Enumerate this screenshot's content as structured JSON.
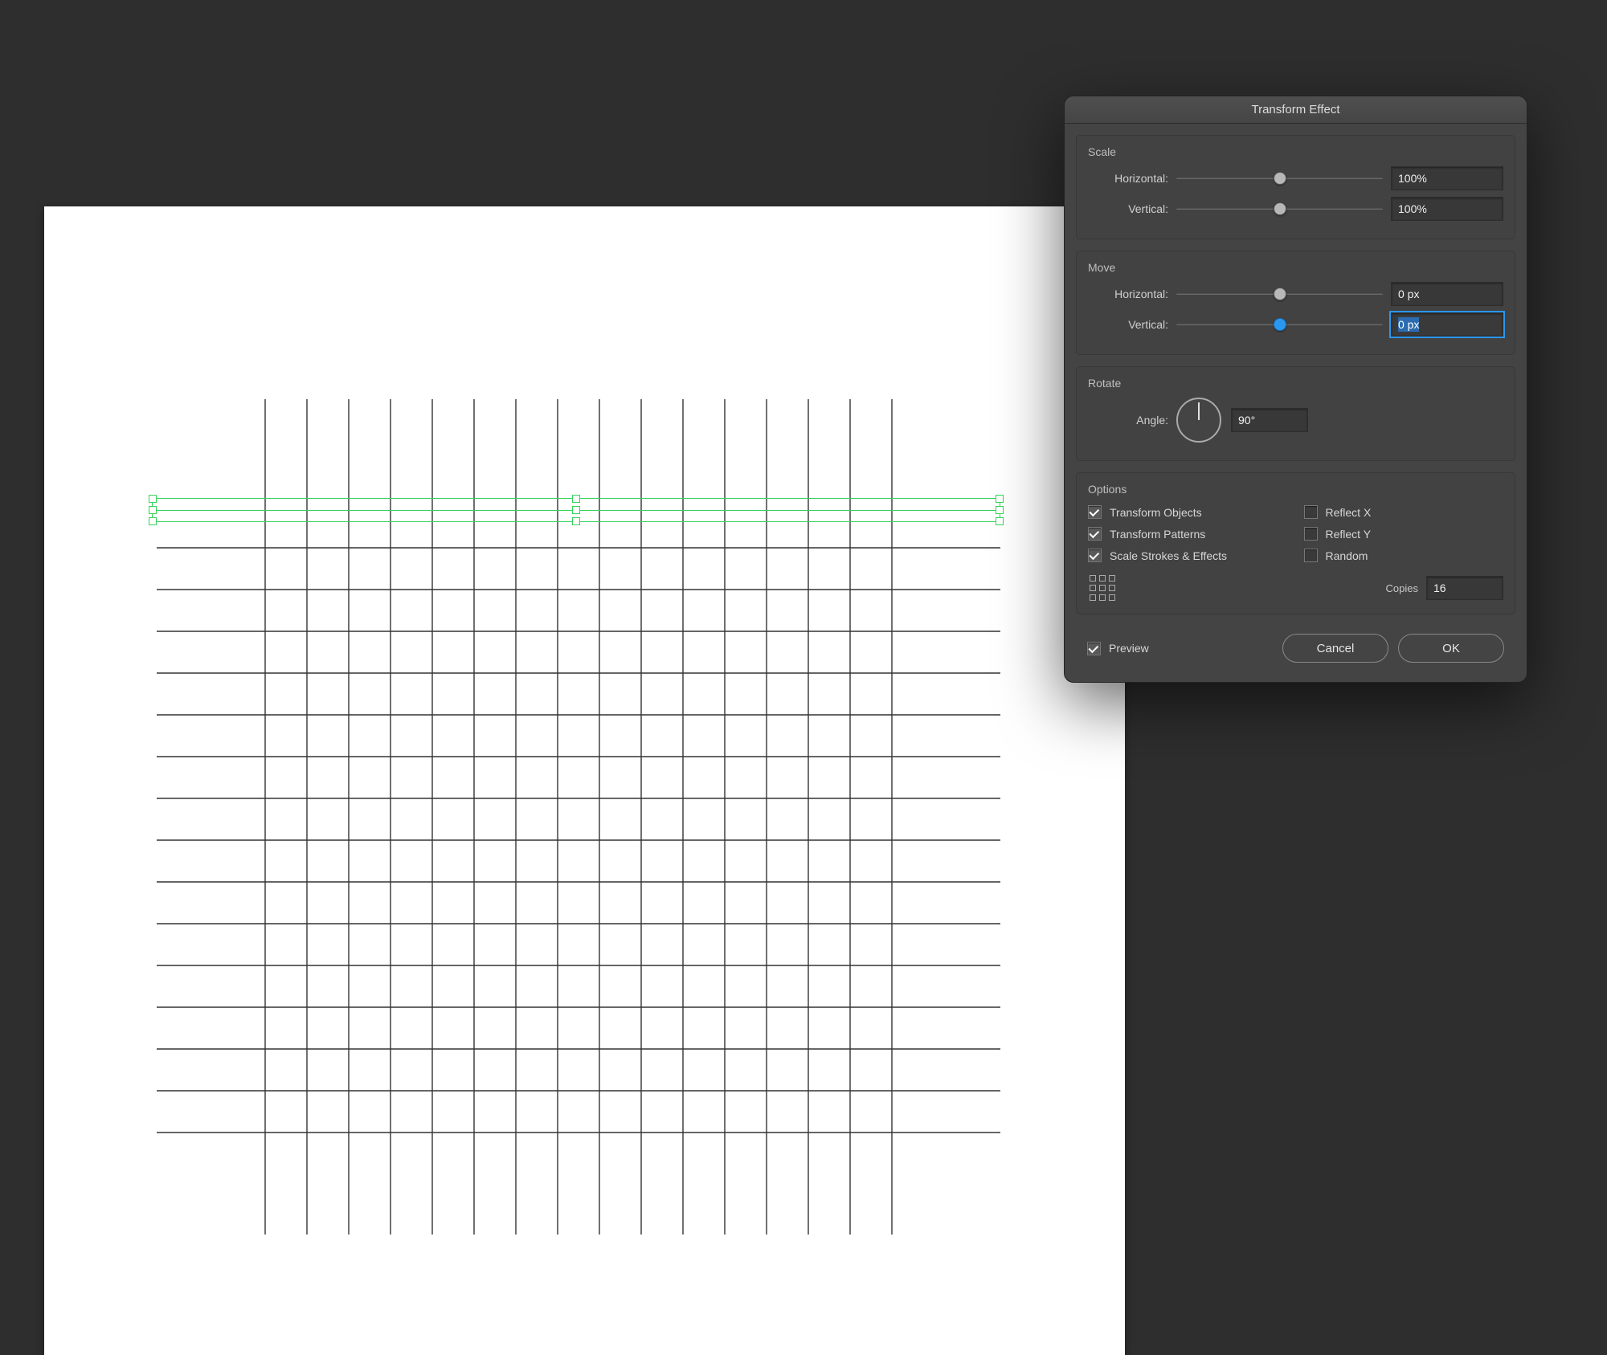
{
  "dialog": {
    "title": "Transform Effect",
    "scale": {
      "title": "Scale",
      "horizontal_label": "Horizontal:",
      "horizontal_value": "100%",
      "vertical_label": "Vertical:",
      "vertical_value": "100%"
    },
    "move": {
      "title": "Move",
      "horizontal_label": "Horizontal:",
      "horizontal_value": "0 px",
      "vertical_label": "Vertical:",
      "vertical_value": "0 px"
    },
    "rotate": {
      "title": "Rotate",
      "angle_label": "Angle:",
      "angle_value": "90°"
    },
    "options": {
      "title": "Options",
      "transform_objects": {
        "label": "Transform Objects",
        "checked": true
      },
      "transform_patterns": {
        "label": "Transform Patterns",
        "checked": true
      },
      "scale_strokes": {
        "label": "Scale Strokes & Effects",
        "checked": true
      },
      "reflect_x": {
        "label": "Reflect X",
        "checked": false
      },
      "reflect_y": {
        "label": "Reflect Y",
        "checked": false
      },
      "random": {
        "label": "Random",
        "checked": false
      },
      "copies_label": "Copies",
      "copies_value": "16"
    },
    "footer": {
      "preview_label": "Preview",
      "preview_checked": true,
      "cancel": "Cancel",
      "ok": "OK"
    }
  }
}
